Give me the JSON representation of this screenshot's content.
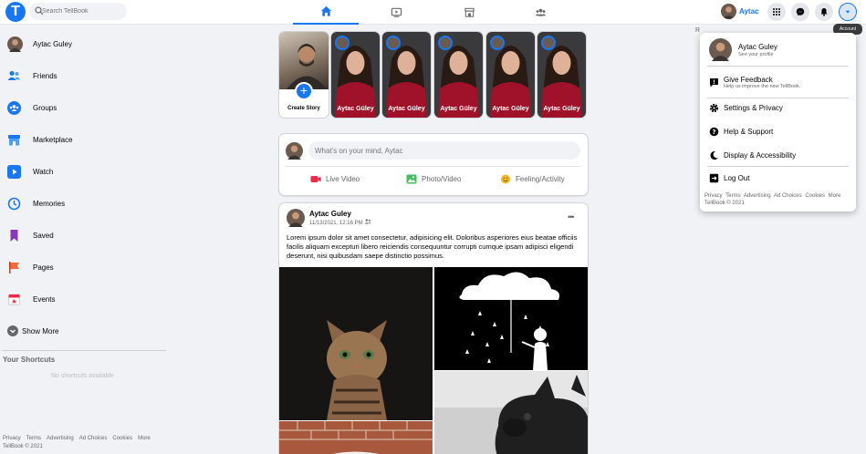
{
  "app": {
    "logo_letter": "T",
    "brand_color": "#1877f2"
  },
  "search": {
    "placeholder": "Search TellBook"
  },
  "nav": {
    "tabs": [
      "home",
      "watch",
      "marketplace",
      "groups"
    ],
    "active": "home"
  },
  "header": {
    "user_name": "Aytac",
    "tooltip": "Account"
  },
  "stray_text": "R",
  "sidebar": {
    "items": [
      {
        "label": "Aytac Guley",
        "icon": "avatar"
      },
      {
        "label": "Friends",
        "icon": "friends-icon"
      },
      {
        "label": "Groups",
        "icon": "groups-icon"
      },
      {
        "label": "Marketplace",
        "icon": "marketplace-icon"
      },
      {
        "label": "Watch",
        "icon": "watch-icon"
      },
      {
        "label": "Memories",
        "icon": "memories-icon"
      },
      {
        "label": "Saved",
        "icon": "saved-icon"
      },
      {
        "label": "Pages",
        "icon": "pages-icon"
      },
      {
        "label": "Events",
        "icon": "events-icon"
      },
      {
        "label": "Show More",
        "icon": "chevron-down-icon"
      }
    ],
    "shortcuts_title": "Your Shortcuts",
    "shortcuts_empty": "No shortcuts available",
    "footer_links": [
      "Privacy",
      "Terms",
      "Advertising",
      "Ad Choices",
      "Cookies",
      "More"
    ],
    "copyright": "TellBook © 2021"
  },
  "stories": {
    "create_label": "Create Story",
    "items": [
      {
        "name": "Aytac Güley"
      },
      {
        "name": "Aytac Güley"
      },
      {
        "name": "Aytac Güley"
      },
      {
        "name": "Aytac Güley"
      },
      {
        "name": "Aytac Güley"
      }
    ]
  },
  "composer": {
    "placeholder": "What's on your mind, Aytac",
    "actions": [
      {
        "label": "Live Video",
        "color": "#f02849"
      },
      {
        "label": "Photo/Video",
        "color": "#45bd62"
      },
      {
        "label": "Feeling/Activity",
        "color": "#f7b928"
      }
    ]
  },
  "post": {
    "author": "Aytac Guley",
    "timestamp": "11/13/2021, 12:16 PM",
    "text": "Lorem ipsum dolor sit amet consectetur, adipisicing elit. Doloribus asperiores eius beatae officiis facilis aliquam excepturi libero reiciendis consequuntur corrupti cumque ipsam adipisci eligendi deserunt, nisi quibusdam saepe distinctio possimus."
  },
  "account_menu": {
    "name": "Aytac Guley",
    "profile_sub": "See your profile",
    "feedback_title": "Give Feedback",
    "feedback_sub": "Help us improve the new TellBook.",
    "items": [
      "Settings & Privacy",
      "Help & Support",
      "Display & Accessibility",
      "Log Out"
    ],
    "footer_links": [
      "Privacy",
      "Terms",
      "Advertising",
      "Ad Choices",
      "Cookies",
      "More"
    ],
    "copyright": "TellBook © 2021"
  }
}
